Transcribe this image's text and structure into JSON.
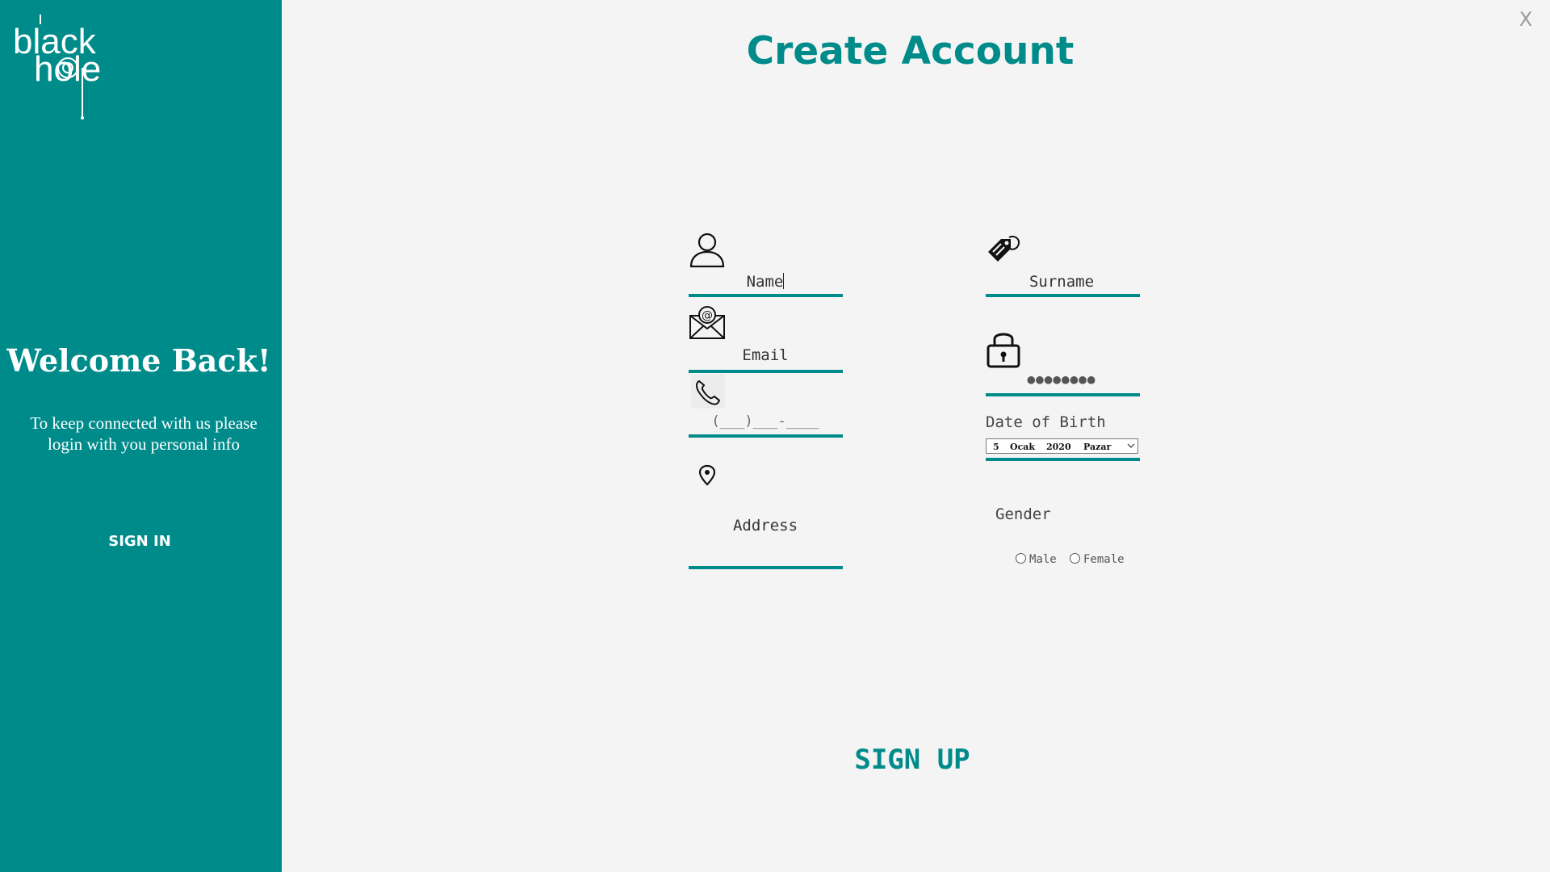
{
  "brand": {
    "logo_text": "black hole",
    "accent_color": "#008b8b"
  },
  "sidebar": {
    "title": "Welcome Back!",
    "message": "To keep connected with us please login with you personal info",
    "signin_label": "SIGN IN"
  },
  "window": {
    "close_label": "X"
  },
  "form": {
    "title": "Create Account",
    "name_value": "Name",
    "surname_value": "Surname",
    "email_value": "Email",
    "password_value": "●●●●●●●●",
    "phone_value": "(___)___-____",
    "address_value": "Address",
    "dob_label": "Date of Birth",
    "dob": {
      "day": "5",
      "month": "Ocak",
      "year": "2020",
      "weekday": "Pazar"
    },
    "gender_label": "Gender",
    "gender_options": [
      "Male",
      "Female"
    ],
    "signup_label": "SIGN UP"
  },
  "icons": {
    "name": "user-icon",
    "surname": "tag-icon",
    "email": "envelope-at-icon",
    "password": "lock-icon",
    "phone": "phone-icon",
    "address": "map-pin-icon",
    "dropdown": "chevron-down-icon"
  }
}
